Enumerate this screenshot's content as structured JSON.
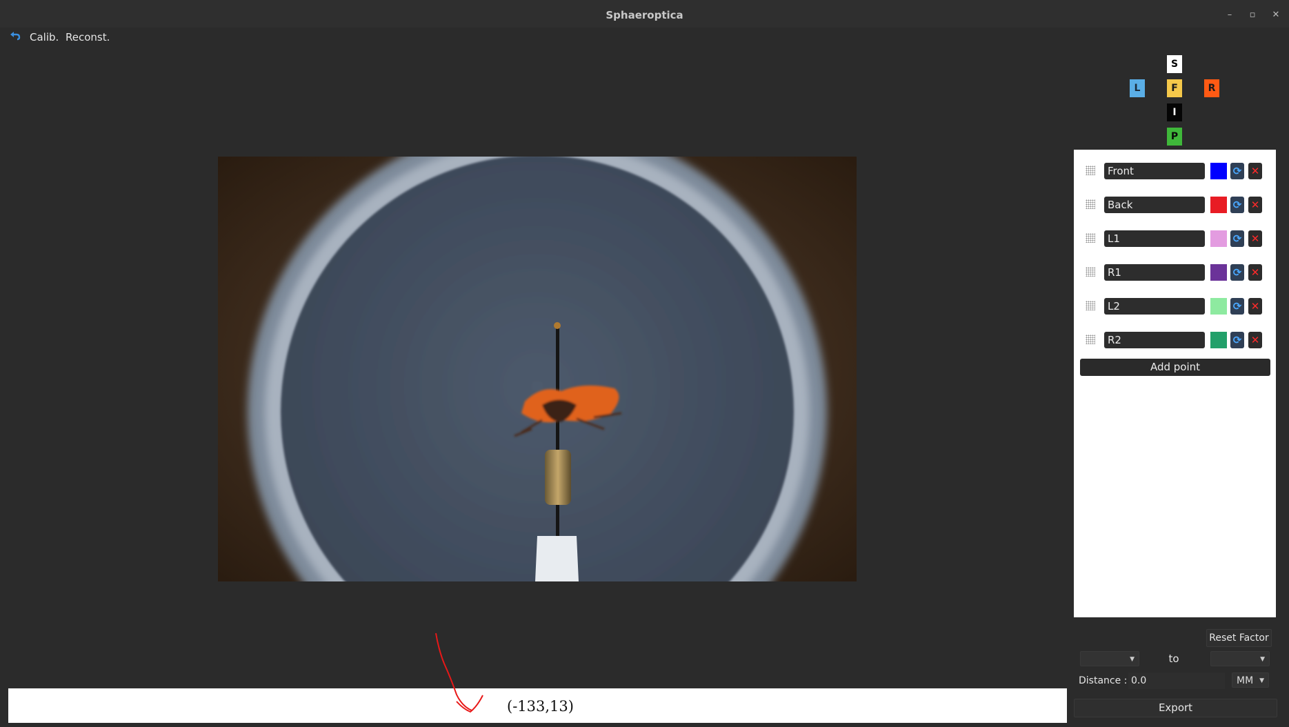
{
  "window": {
    "title": "Sphaeroptica",
    "controls": {
      "minimize": "–",
      "maximize": "▫",
      "close": "✕"
    }
  },
  "menubar": {
    "undo_icon": "undo-arrow-icon",
    "items": [
      "Calib.",
      "Reconst."
    ]
  },
  "view_selector": [
    {
      "key": "S",
      "label": "S",
      "bg": "#ffffff",
      "fg": "#000000"
    },
    {
      "key": "L",
      "label": "L",
      "bg": "#5aaee6",
      "fg": "#1a2a3a"
    },
    {
      "key": "F",
      "label": "F",
      "bg": "#f5c84a",
      "fg": "#1a1a1a"
    },
    {
      "key": "R",
      "label": "R",
      "bg": "#ff5a14",
      "fg": "#1a1a1a"
    },
    {
      "key": "I",
      "label": "I",
      "bg": "#050505",
      "fg": "#ffffff"
    },
    {
      "key": "P",
      "label": "P",
      "bg": "#3fb83a",
      "fg": "#0a0a0a"
    }
  ],
  "points": [
    {
      "name": "Front",
      "color": "#0000ff"
    },
    {
      "name": "Back",
      "color": "#e81c24"
    },
    {
      "name": "L1",
      "color": "#e39ce0"
    },
    {
      "name": "R1",
      "color": "#6b3399"
    },
    {
      "name": "L2",
      "color": "#8eeaa0"
    },
    {
      "name": "R2",
      "color": "#23a06a"
    }
  ],
  "point_icons": {
    "handle": "drag-handle-icon",
    "refresh": "refresh-icon",
    "delete": "delete-x-icon",
    "refresh_glyph": "⟳",
    "delete_glyph": "✕"
  },
  "add_point_label": "Add point",
  "reset_factor_label": "Reset Factor",
  "range": {
    "from": "",
    "to_label": "to",
    "to": ""
  },
  "distance": {
    "label": "Distance :",
    "value": "0.0",
    "unit": "MM"
  },
  "export_label": "Export",
  "status": {
    "coords": "(-133,13)"
  },
  "image": {
    "alt": "insect specimen on a pin inside a circular calibration lens view"
  }
}
